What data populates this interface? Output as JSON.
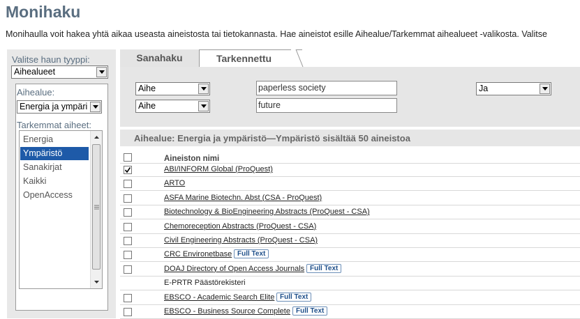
{
  "page": {
    "title": "Monihaku",
    "intro": "Monihaulla voit hakea yhtä aikaa useasta aineistosta tai tietokannasta. Hae aineistot esille Aihealue/Tarkemmat aihealueet -valikosta. Valitse"
  },
  "left": {
    "search_type_label": "Valitse haun tyyppi:",
    "search_type_value": "Aihealueet",
    "subject_label": "Aihealue:",
    "subject_value": "Energia ja ympäri",
    "subtopics_label": "Tarkemmat aiheet:",
    "subtopics": [
      {
        "label": "Energia",
        "selected": false
      },
      {
        "label": "Ympäristö",
        "selected": true
      },
      {
        "label": "Sanakirjat",
        "selected": false
      },
      {
        "label": "Kaikki",
        "selected": false
      },
      {
        "label": "OpenAccess",
        "selected": false
      }
    ]
  },
  "tabs": [
    {
      "label": "Sanahaku",
      "active": false
    },
    {
      "label": "Tarkennettu",
      "active": true
    }
  ],
  "search": {
    "field1_select": "Aihe",
    "field1_value": "paperless society",
    "field2_select": "Aihe",
    "field2_value": "future",
    "operator": "Ja"
  },
  "results": {
    "header": "Aihealue: Energia ja ympäristö—Ympäristö sisältää 50 aineistoa",
    "column_header": "Aineiston nimi",
    "full_text_label": "Full Text",
    "items": [
      {
        "name": "ABI/INFORM Global (ProQuest)",
        "checked": true,
        "checkbox": true,
        "full_text": false,
        "link": true
      },
      {
        "name": "ARTO",
        "checked": false,
        "checkbox": true,
        "full_text": false,
        "link": true
      },
      {
        "name": "ASFA Marine Biotechn. Abst (CSA - ProQuest)",
        "checked": false,
        "checkbox": true,
        "full_text": false,
        "link": true
      },
      {
        "name": "Biotechnology & BioEngineering Abstracts (ProQuest - CSA)",
        "checked": false,
        "checkbox": true,
        "full_text": false,
        "link": true
      },
      {
        "name": "Chemoreception Abstracts (ProQuest - CSA)",
        "checked": false,
        "checkbox": true,
        "full_text": false,
        "link": true
      },
      {
        "name": "Civil Engineering Abstracts (ProQuest - CSA)",
        "checked": false,
        "checkbox": true,
        "full_text": false,
        "link": true
      },
      {
        "name": "CRC Environetbase",
        "checked": false,
        "checkbox": true,
        "full_text": true,
        "link": true
      },
      {
        "name": "DOAJ Directory of Open Access Journals",
        "checked": false,
        "checkbox": true,
        "full_text": true,
        "link": true
      },
      {
        "name": "E-PRTR Päästörekisteri",
        "checked": false,
        "checkbox": false,
        "full_text": false,
        "link": false
      },
      {
        "name": "EBSCO - Academic Search Elite",
        "checked": false,
        "checkbox": true,
        "full_text": true,
        "link": true
      },
      {
        "name": "EBSCO - Business Source Complete",
        "checked": false,
        "checkbox": true,
        "full_text": true,
        "link": true
      }
    ]
  }
}
